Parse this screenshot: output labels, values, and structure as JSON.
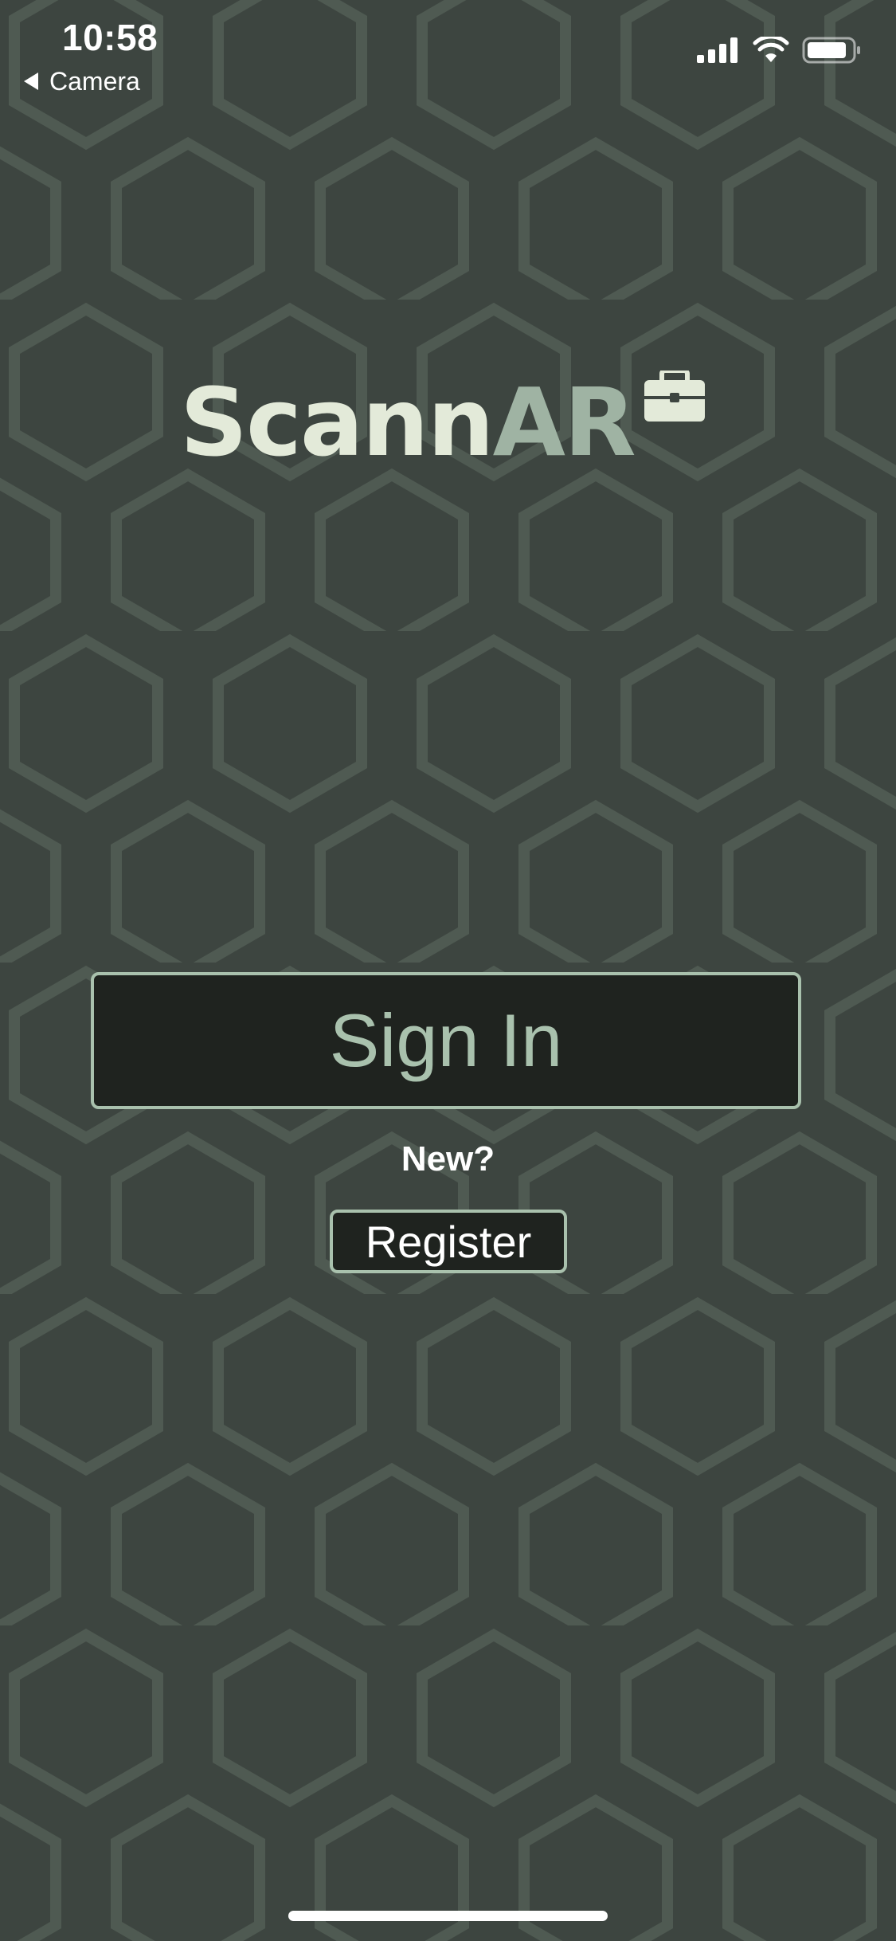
{
  "status_bar": {
    "time": "10:58",
    "back_label": "Camera",
    "icons": [
      "cellular-signal-icon",
      "wifi-icon",
      "battery-icon"
    ]
  },
  "logo": {
    "part1": "Scann",
    "part2": "AR",
    "icon": "briefcase-icon"
  },
  "actions": {
    "sign_in_label": "Sign In",
    "new_label": "New?",
    "register_label": "Register"
  },
  "colors": {
    "background": "#3d4540",
    "hexagon_pattern": "#4f5a52",
    "button_fill": "#1f231f",
    "button_border": "#a9c1ad",
    "logo_light": "#e3ead9",
    "logo_accent": "#9fb3a3"
  }
}
